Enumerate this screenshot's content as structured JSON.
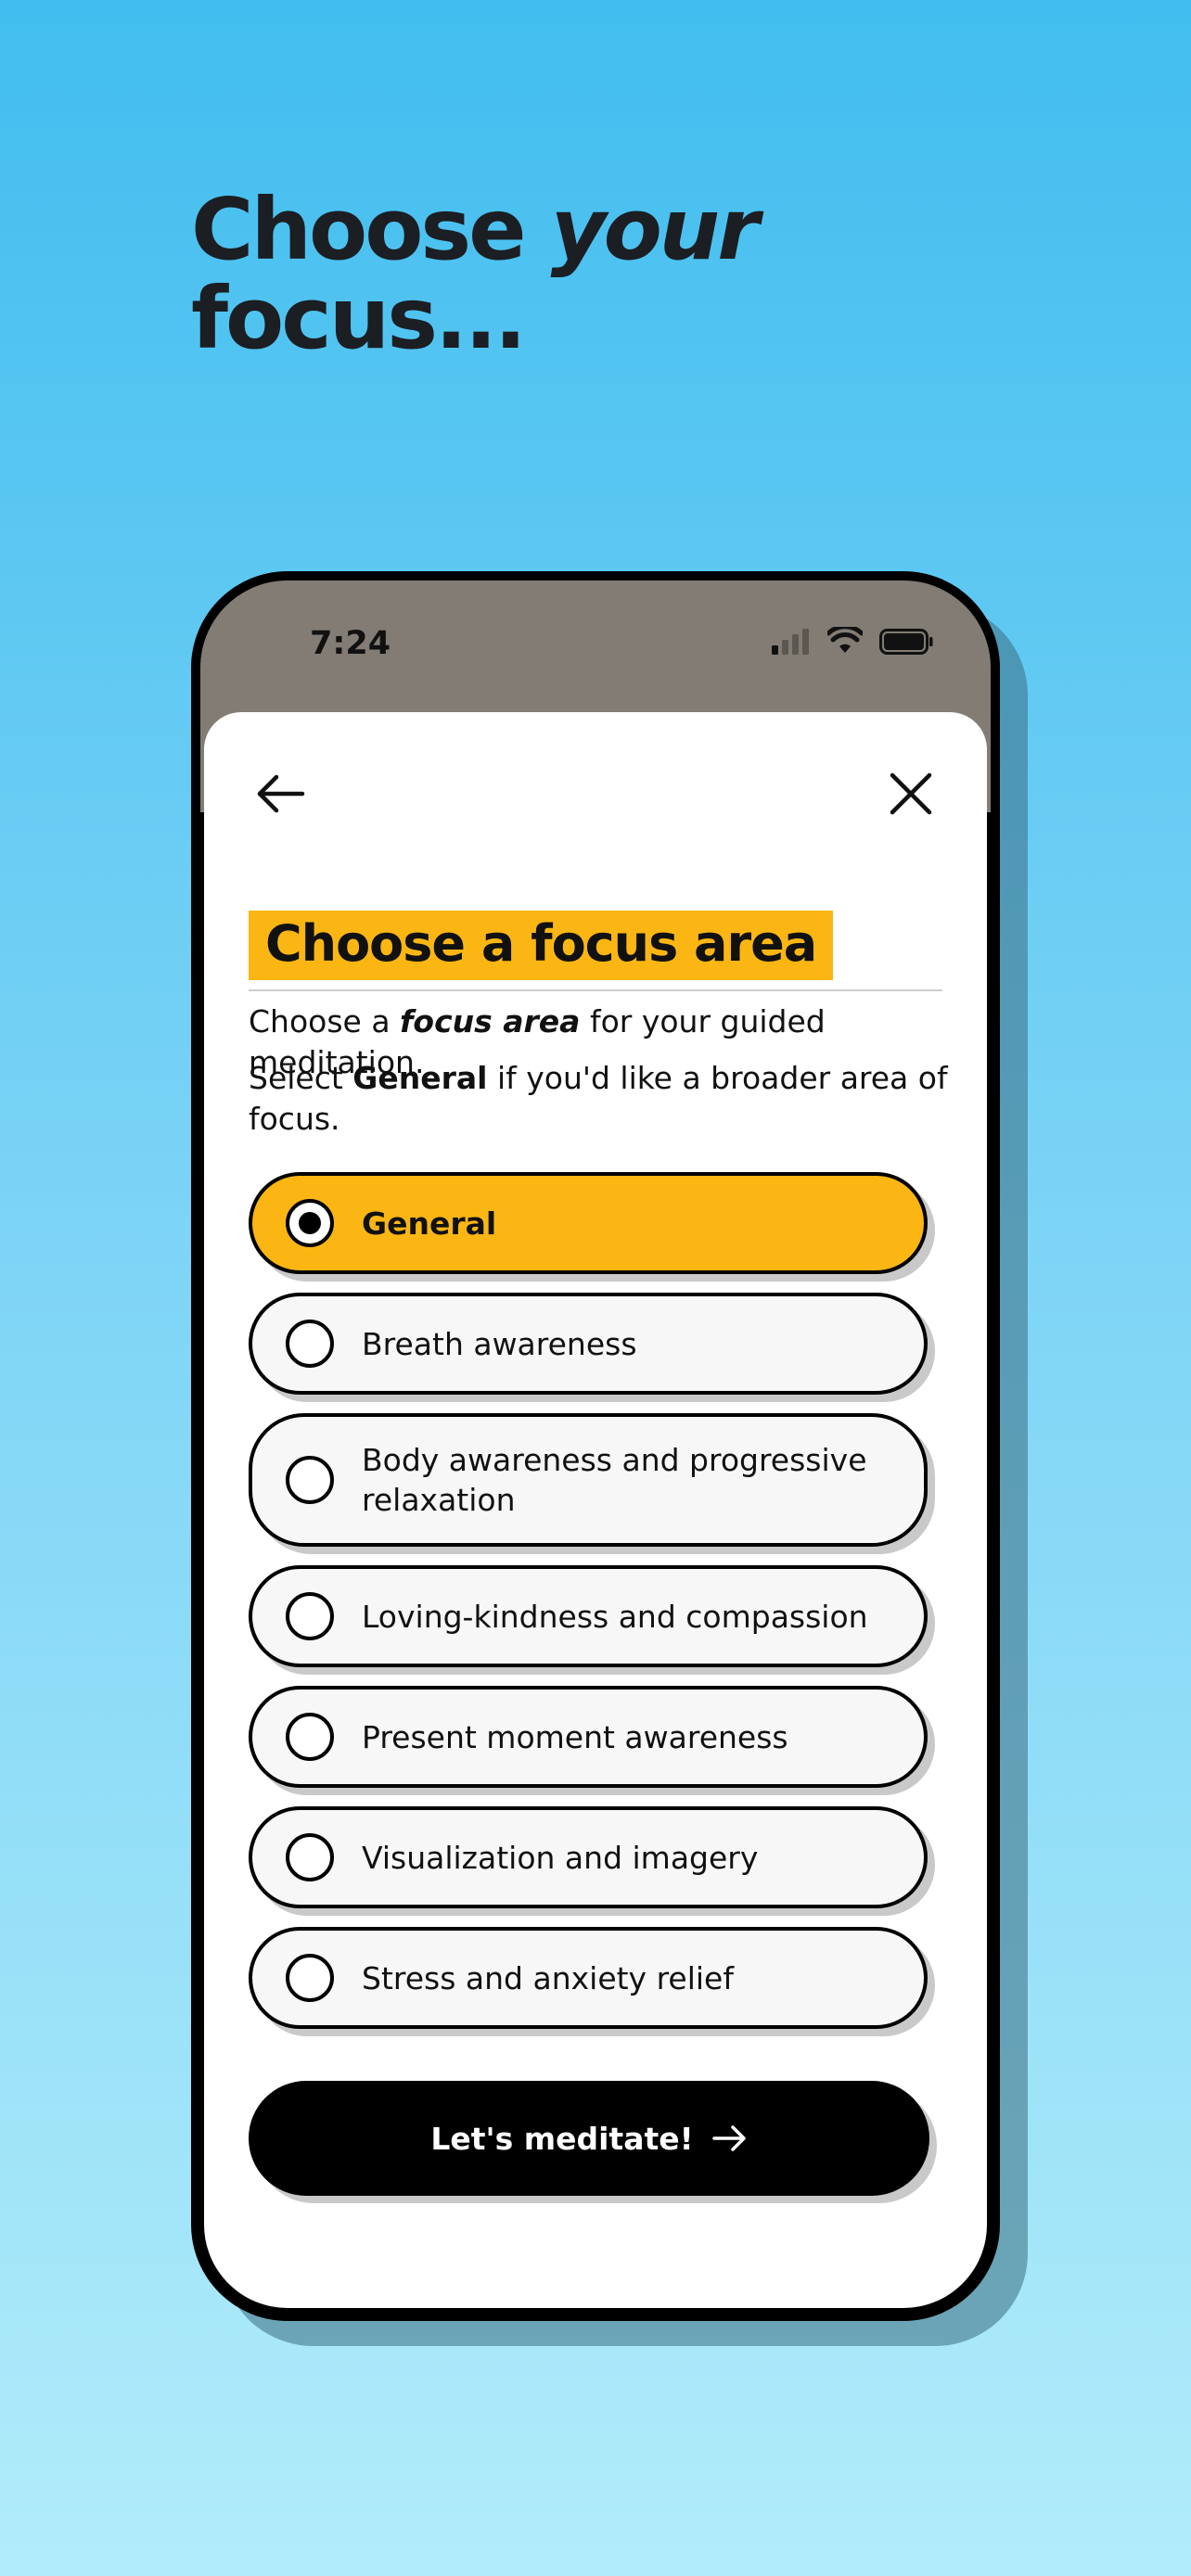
{
  "headline": {
    "line1_plain": "Choose ",
    "line1_italic": "your",
    "line2": "focus..."
  },
  "status_bar": {
    "time": "7:24",
    "icons": [
      "signal-icon",
      "wifi-icon",
      "battery-icon"
    ]
  },
  "nav": {
    "back_icon": "arrow-left-icon",
    "close_icon": "close-icon"
  },
  "page": {
    "title": "Choose a focus area",
    "desc1_pre": "Choose a ",
    "desc1_em": "focus area",
    "desc1_post": " for your guided meditation.",
    "desc2_pre": "Select ",
    "desc2_strong": "General",
    "desc2_post": " if you'd like a broader area of focus."
  },
  "options": [
    {
      "label": "General",
      "selected": true
    },
    {
      "label": "Breath awareness",
      "selected": false
    },
    {
      "label": "Body awareness and progressive relaxation",
      "selected": false
    },
    {
      "label": "Loving-kindness and compassion",
      "selected": false
    },
    {
      "label": "Present moment awareness",
      "selected": false
    },
    {
      "label": "Visualization and imagery",
      "selected": false
    },
    {
      "label": "Stress and anxiety relief",
      "selected": false
    }
  ],
  "cta": {
    "label": "Let's meditate!",
    "icon": "arrow-right-icon"
  },
  "colors": {
    "accent": "#fbb614",
    "status_bar": "#827c74",
    "text": "#111111"
  }
}
